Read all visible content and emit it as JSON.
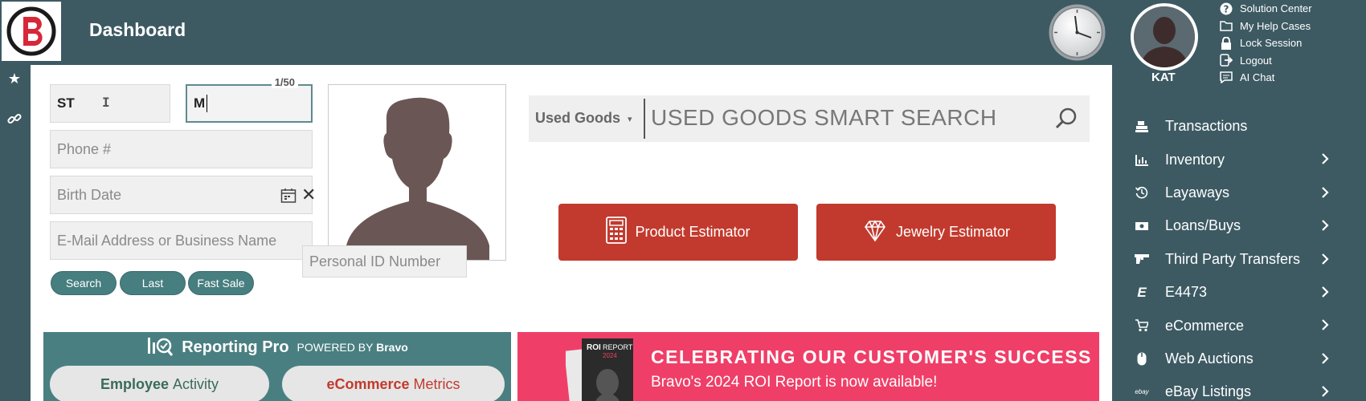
{
  "header": {
    "title": "Dashboard",
    "user_name": "KAT",
    "help_links": [
      {
        "label": "Solution Center",
        "icon": "question-circle-icon"
      },
      {
        "label": "My Help Cases",
        "icon": "folder-icon"
      },
      {
        "label": "Lock Session",
        "icon": "lock-icon"
      },
      {
        "label": "Logout",
        "icon": "logout-icon"
      },
      {
        "label": "AI Chat",
        "icon": "chat-icon"
      }
    ]
  },
  "rail": {
    "icons": [
      "star-icon",
      "link-icon"
    ]
  },
  "customer_form": {
    "first_name_value": "ST",
    "last_name_value": "M",
    "last_name_counter": "1/50",
    "phone_placeholder": "Phone #",
    "birth_date_placeholder": "Birth Date",
    "email_placeholder": "E-Mail Address or Business Name",
    "personal_id_placeholder": "Personal ID Number",
    "buttons": {
      "search": "Search",
      "last": "Last",
      "fast_sale": "Fast Sale"
    }
  },
  "smart_search": {
    "category": "Used Goods",
    "placeholder": "USED GOODS SMART SEARCH"
  },
  "estimators": {
    "product": "Product Estimator",
    "jewelry": "Jewelry Estimator"
  },
  "reporting": {
    "title": "Reporting Pro",
    "powered_prefix": "POWERED BY",
    "powered_brand": "Bravo",
    "tab1_bold": "Employee",
    "tab1_rest": "Activity",
    "tab2_bold": "eCommerce",
    "tab2_rest": "Metrics"
  },
  "banner": {
    "report_label": "ROI REPORT 2024",
    "title": "CELEBRATING OUR CUSTOMER'S SUCCESS",
    "subtitle": "Bravo's 2024 ROI Report is now available!"
  },
  "nav": {
    "items": [
      {
        "label": "Transactions",
        "icon": "register-icon",
        "chevron": false
      },
      {
        "label": "Inventory",
        "icon": "chart-icon",
        "chevron": true
      },
      {
        "label": "Layaways",
        "icon": "history-icon",
        "chevron": true
      },
      {
        "label": "Loans/Buys",
        "icon": "money-icon",
        "chevron": true
      },
      {
        "label": "Third Party Transfers",
        "icon": "gun-icon",
        "chevron": true
      },
      {
        "label": "E4473",
        "icon": "e-icon",
        "chevron": true
      },
      {
        "label": "eCommerce",
        "icon": "cart-icon",
        "chevron": true
      },
      {
        "label": "Web Auctions",
        "icon": "mouse-icon",
        "chevron": true
      },
      {
        "label": "eBay Listings",
        "icon": "ebay-icon",
        "chevron": true
      }
    ]
  },
  "colors": {
    "header_bg": "#3d5a63",
    "teal_button": "#477e80",
    "red_button": "#c23a2e",
    "banner_pink": "#ef3f68"
  }
}
